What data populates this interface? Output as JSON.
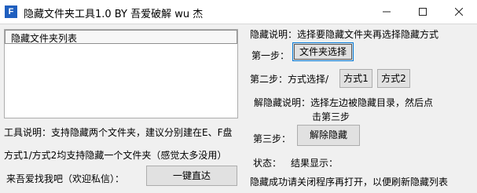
{
  "window": {
    "title": "隐藏文件夹工具1.0 BY 吾爱破解 wu 杰",
    "icon_letter": "F"
  },
  "list": {
    "column_header": "隐藏文件夹列表"
  },
  "left_text": {
    "tool_desc": "工具说明：支持隐藏两个文件夹，建议分别建在E、F盘",
    "mode_desc": "方式1/方式2均支持隐藏一个文件夹（感觉太多没用）",
    "contact_label": "来吾爱找我吧（欢迎私信）："
  },
  "buttons": {
    "direct": "一键直达",
    "choose_folder": "文件夹选择",
    "mode1": "方式1",
    "mode2": "方式2",
    "unhide": "解除隐藏"
  },
  "right_text": {
    "hide_desc": "隐藏说明：选择要隐藏文件夹再选择隐藏方式",
    "step1": "第一步：",
    "step2": "第二步：方式选择/",
    "unhide_desc_line1": "解隐藏说明：选择左边被隐藏目录，然后点",
    "unhide_desc_line2": "击第三步",
    "step3": "第三步：",
    "status_label": "状态：",
    "result_label": "结果显示：",
    "note": "隐藏成功请关闭程序再打开，以便刷新隐藏列表"
  },
  "colors": {
    "app_icon_bg": "#1f5fbf",
    "button_bg": "#e1e1e1",
    "focus_border": "#0078d7"
  }
}
